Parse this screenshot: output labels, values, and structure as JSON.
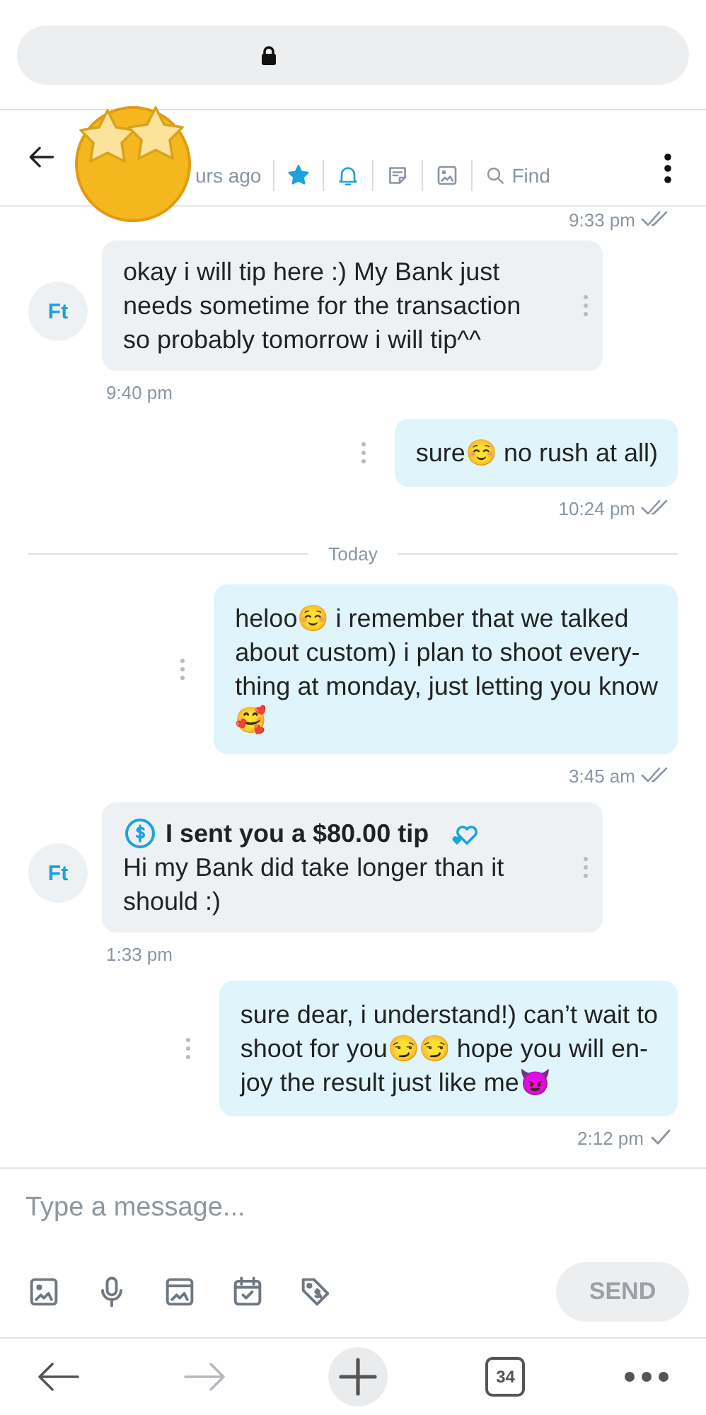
{
  "browser": {
    "secure": true
  },
  "header": {
    "status": "urs ago",
    "tools": [
      {
        "kind": "star",
        "on": true
      },
      {
        "kind": "bell",
        "on": true
      },
      {
        "kind": "note",
        "on": false
      },
      {
        "kind": "image",
        "on": false
      },
      {
        "kind": "search",
        "label": "Find"
      }
    ]
  },
  "messages": [
    {
      "kind": "status",
      "time": "9:33 pm",
      "read": true
    },
    {
      "kind": "incoming",
      "avatar": "Ft",
      "text": "okay i will tip here :) My Bank just\nneeds sometime for the transaction\nso probably tomorrow i will tip^^",
      "time": "9:40 pm"
    },
    {
      "kind": "outgoing",
      "text": "sure☺️ no rush at all)",
      "time": "10:24 pm",
      "read": true
    },
    {
      "kind": "divider",
      "label": "Today"
    },
    {
      "kind": "outgoing",
      "text": "heloo☺️ i remember that we talked\nabout custom) i plan to shoot every-\nthing at monday, just letting you know\n🥰",
      "time": "3:45 am",
      "read": true
    },
    {
      "kind": "tip",
      "avatar": "Ft",
      "tip": "I sent you a $80.00 tip",
      "text": "Hi my Bank did take longer than it\nshould :)",
      "time": "1:33 pm"
    },
    {
      "kind": "outgoing",
      "text": "sure dear, i understand!) can’t wait to\nshoot for you😏😏 hope you will en-\njoy the result just like me😈",
      "time": "2:12 pm",
      "read": false
    }
  ],
  "composer": {
    "placeholder": "Type a message...",
    "tools": [
      {
        "kind": "image"
      },
      {
        "kind": "mic"
      },
      {
        "kind": "media"
      },
      {
        "kind": "calendar"
      },
      {
        "kind": "price"
      }
    ],
    "send": {
      "label": "SEND",
      "disabled": true
    }
  },
  "nav": [
    {
      "kind": "back",
      "disabled": false
    },
    {
      "kind": "forward",
      "disabled": true
    },
    {
      "kind": "new"
    },
    {
      "kind": "tabs",
      "label": "34"
    },
    {
      "kind": "more"
    }
  ]
}
